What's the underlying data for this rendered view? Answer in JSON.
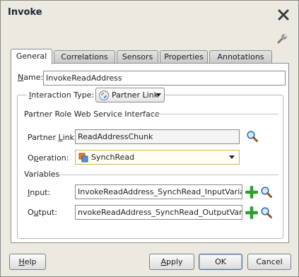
{
  "window": {
    "title": "Invoke"
  },
  "tabs": [
    {
      "label": "General",
      "active": true
    },
    {
      "label": "Correlations"
    },
    {
      "label": "Sensors"
    },
    {
      "label": "Properties"
    },
    {
      "label": "Annotations"
    }
  ],
  "general": {
    "name_label_u": "N",
    "name_label_rest": "ame:",
    "name_value": "InvokeReadAddress",
    "interaction_label_pre": " ",
    "interaction_label_u": "I",
    "interaction_label_rest": "nteraction Type:",
    "interaction_value": "Partner Link",
    "partner_role_heading": "Partner Role Web Service Interface",
    "partner_link_label_pre": "Partner ",
    "partner_link_label_u": "L",
    "partner_link_label_rest": "ink:",
    "partner_link_value": "ReadAddressChunk",
    "operation_label_pre": "O",
    "operation_label_u": "p",
    "operation_label_rest": "eration:",
    "operation_value": "SynchRead",
    "variables_heading": "Variables",
    "input_label_u": "I",
    "input_label_rest": "nput:",
    "input_value": "InvokeReadAddress_SynchRead_InputVariable",
    "output_label_pre": "O",
    "output_label_u": "u",
    "output_label_rest": "tput:",
    "output_value": "nvokeReadAddress_SynchRead_OutputVariable"
  },
  "buttons": {
    "help_u": "H",
    "help_rest": "elp",
    "apply_u": "A",
    "apply_rest": "pply",
    "ok": "OK",
    "cancel": "Cancel"
  },
  "icons": {
    "close": "close-icon",
    "wrench": "wrench-icon",
    "search": "search-icon",
    "add": "add-icon",
    "partner_link": "partner-link-icon",
    "operation": "operation-icon"
  },
  "colors": {
    "dialog_bg": "#ece9e0",
    "add_green": "#2e9e2e",
    "select_border": "#d9b35a"
  }
}
